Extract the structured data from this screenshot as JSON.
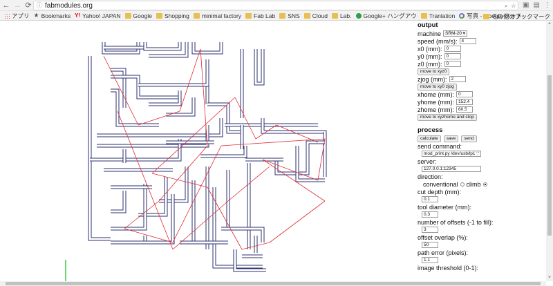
{
  "browser": {
    "url": "fabmodules.org",
    "other_bookmarks": "その他のブックマーク"
  },
  "bookmarks": [
    {
      "label": "アプリ",
      "icon": "apps-icon"
    },
    {
      "label": "Bookmarks",
      "icon": "star-icon"
    },
    {
      "label": "Yahoo! JAPAN",
      "icon": "yahoo-icon"
    },
    {
      "label": "Google",
      "icon": "folder-icon"
    },
    {
      "label": "Shopping",
      "icon": "folder-icon"
    },
    {
      "label": "minimal factory",
      "icon": "folder-icon"
    },
    {
      "label": "Fab Lab",
      "icon": "folder-icon"
    },
    {
      "label": "SNS",
      "icon": "folder-icon"
    },
    {
      "label": "Cloud",
      "icon": "folder-icon"
    },
    {
      "label": "Lab.",
      "icon": "folder-icon"
    },
    {
      "label": "Google+ ハングアウ",
      "icon": "hangouts-icon"
    },
    {
      "label": "Tranlation",
      "icon": "folder-icon"
    },
    {
      "label": "写真 - Google フォト",
      "icon": "photos-icon"
    }
  ],
  "output": {
    "title": "output",
    "machine_label": "machine",
    "machine_value": "SRM-20",
    "speed_label": "speed (mm/s):",
    "speed_value": "4",
    "x0_label": "x0 (mm):",
    "x0_value": "0",
    "y0_label": "y0 (mm):",
    "y0_value": "0",
    "z0_label": "z0 (mm):",
    "z0_value": "0",
    "move_xyz0": "move to xyz0",
    "zjog_label": "zjog (mm):",
    "zjog_value": "2",
    "move_xy0_zjog": "move to xy0 zjog",
    "xhome_label": "xhome (mm):",
    "xhome_value": "0",
    "yhome_label": "yhome (mm):",
    "yhome_value": "152.4",
    "zhome_label": "zhome (mm):",
    "zhome_value": "60.5",
    "move_home_stop": "move to xyzhome and stop"
  },
  "process": {
    "title": "process",
    "calculate": "calculate",
    "save": "save",
    "send": "send",
    "send_command_label": "send command:",
    "send_command_value": "mod_print.py /dev/usb/lp1 ';'",
    "server_label": "server:",
    "server_value": "127.0.0.1:12345",
    "direction_label": "direction:",
    "conventional": "conventional",
    "climb": "climb",
    "cut_depth_label": "cut depth (mm):",
    "cut_depth_value": "0.1",
    "tool_diameter_label": "tool diameter (mm):",
    "tool_diameter_value": "0.3",
    "offsets_label": "number of offsets (-1 to fill):",
    "offsets_value": "3",
    "overlap_label": "offset overlap (%):",
    "overlap_value": "50",
    "path_error_label": "path error (pixels):",
    "path_error_value": "1.1",
    "image_threshold_label": "image threshold (0-1):"
  },
  "colors": {
    "toolpath": "#2b2f6e",
    "rapid_moves": "#e0292f",
    "axis": "#37c837"
  }
}
